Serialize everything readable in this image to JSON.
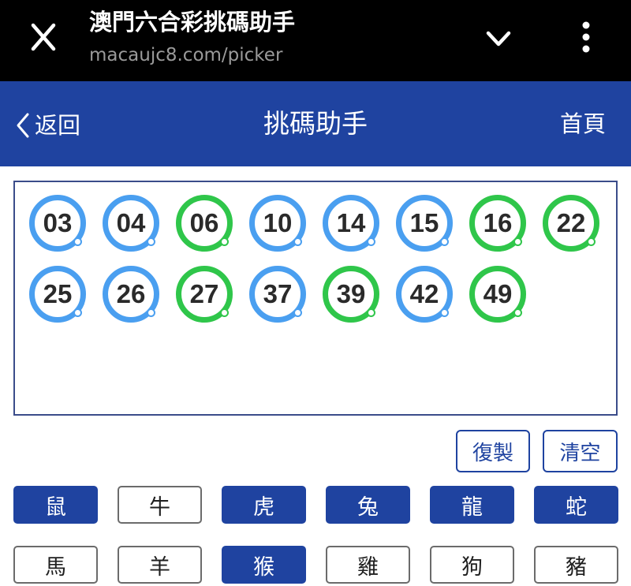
{
  "browser": {
    "title": "澳門六合彩挑碼助手",
    "url": "macaujc8.com/picker"
  },
  "header": {
    "back_label": "返回",
    "title": "挑碼助手",
    "home_label": "首頁"
  },
  "colors": {
    "brand": "#1f43a0",
    "ball_blue": "#4a9ff0",
    "ball_green": "#2fc64a"
  },
  "balls": [
    {
      "number": "03",
      "color": "blue"
    },
    {
      "number": "04",
      "color": "blue"
    },
    {
      "number": "06",
      "color": "green"
    },
    {
      "number": "10",
      "color": "blue"
    },
    {
      "number": "14",
      "color": "blue"
    },
    {
      "number": "15",
      "color": "blue"
    },
    {
      "number": "16",
      "color": "green"
    },
    {
      "number": "22",
      "color": "green"
    },
    {
      "number": "25",
      "color": "blue"
    },
    {
      "number": "26",
      "color": "blue"
    },
    {
      "number": "27",
      "color": "green"
    },
    {
      "number": "37",
      "color": "blue"
    },
    {
      "number": "39",
      "color": "green"
    },
    {
      "number": "42",
      "color": "blue"
    },
    {
      "number": "49",
      "color": "green"
    }
  ],
  "actions": {
    "copy_label": "復製",
    "clear_label": "清空"
  },
  "zodiacs": [
    {
      "label": "鼠",
      "selected": true
    },
    {
      "label": "牛",
      "selected": false
    },
    {
      "label": "虎",
      "selected": true
    },
    {
      "label": "兔",
      "selected": true
    },
    {
      "label": "龍",
      "selected": true
    },
    {
      "label": "蛇",
      "selected": true
    },
    {
      "label": "馬",
      "selected": false
    },
    {
      "label": "羊",
      "selected": false
    },
    {
      "label": "猴",
      "selected": true
    },
    {
      "label": "雞",
      "selected": false
    },
    {
      "label": "狗",
      "selected": false
    },
    {
      "label": "豬",
      "selected": false
    }
  ]
}
